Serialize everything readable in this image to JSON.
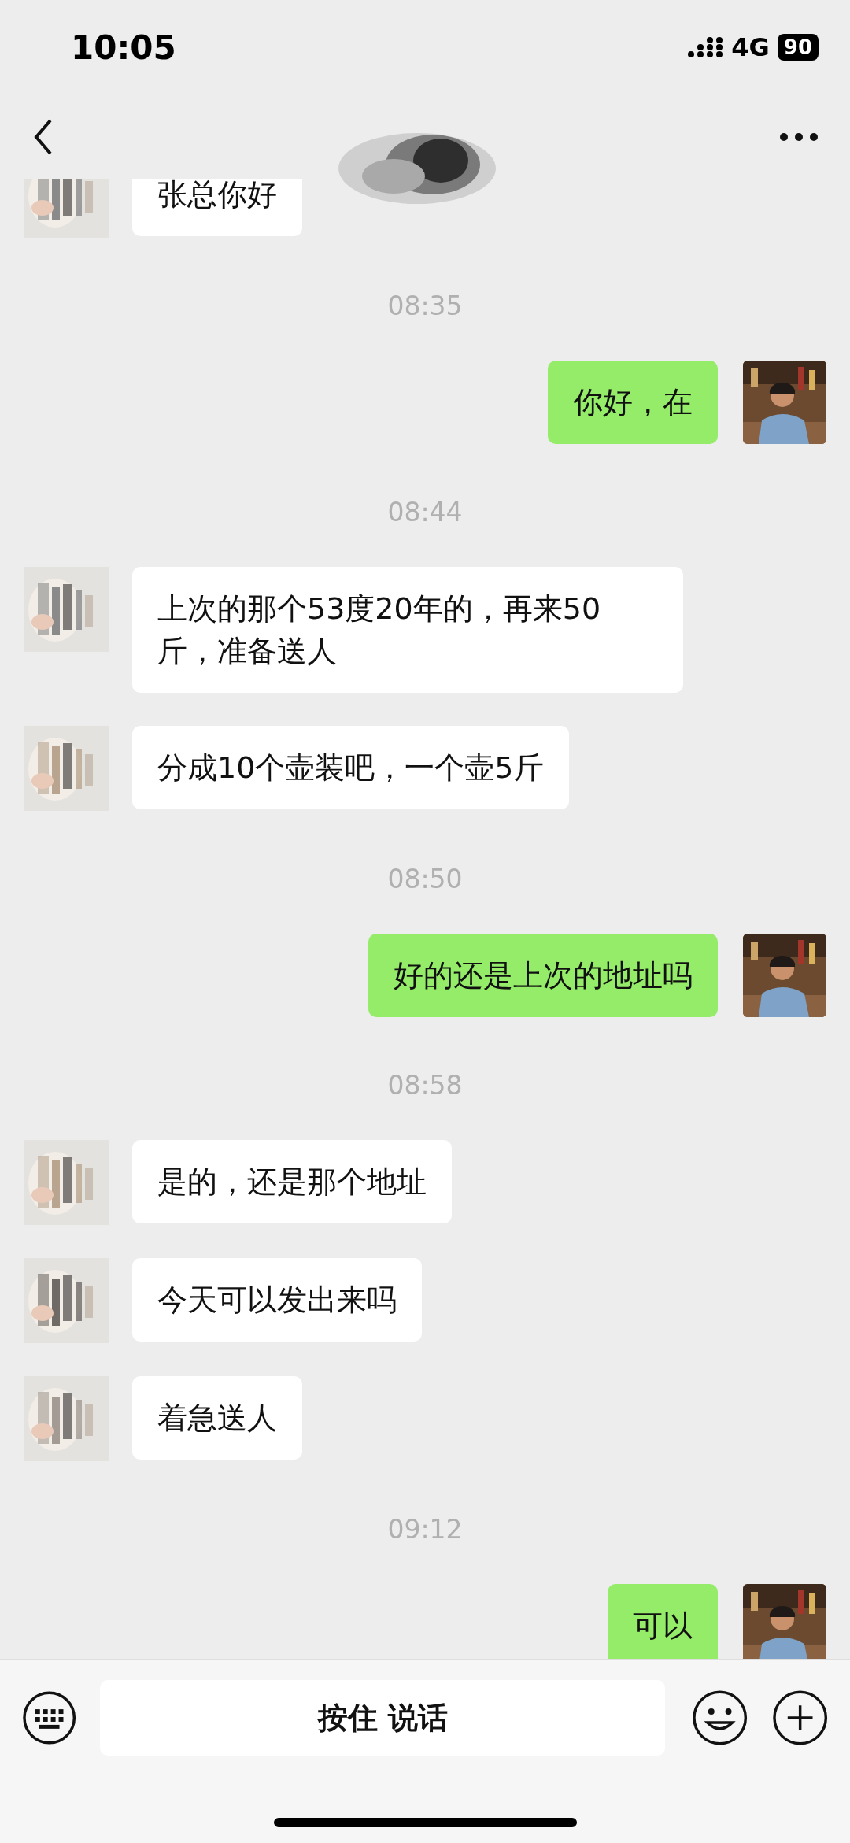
{
  "status_bar": {
    "time": "10:05",
    "network": "4G",
    "battery": "90"
  },
  "messages": [
    {
      "kind": "received",
      "text": "张总你好"
    },
    {
      "kind": "time",
      "text": "08:35"
    },
    {
      "kind": "sent",
      "text": "你好，在"
    },
    {
      "kind": "time",
      "text": "08:44"
    },
    {
      "kind": "received",
      "text": "上次的那个53度20年的，再来50斤，准备送人"
    },
    {
      "kind": "received",
      "text": "分成10个壶装吧，一个壶5斤"
    },
    {
      "kind": "time",
      "text": "08:50"
    },
    {
      "kind": "sent",
      "text": "好的还是上次的地址吗"
    },
    {
      "kind": "time",
      "text": "08:58"
    },
    {
      "kind": "received",
      "text": "是的，还是那个地址"
    },
    {
      "kind": "received",
      "text": "今天可以发出来吗"
    },
    {
      "kind": "received",
      "text": "着急送人"
    },
    {
      "kind": "time",
      "text": "09:12"
    },
    {
      "kind": "sent",
      "text": "可以"
    }
  ],
  "input_bar": {
    "talk_button": "按住 说话"
  }
}
